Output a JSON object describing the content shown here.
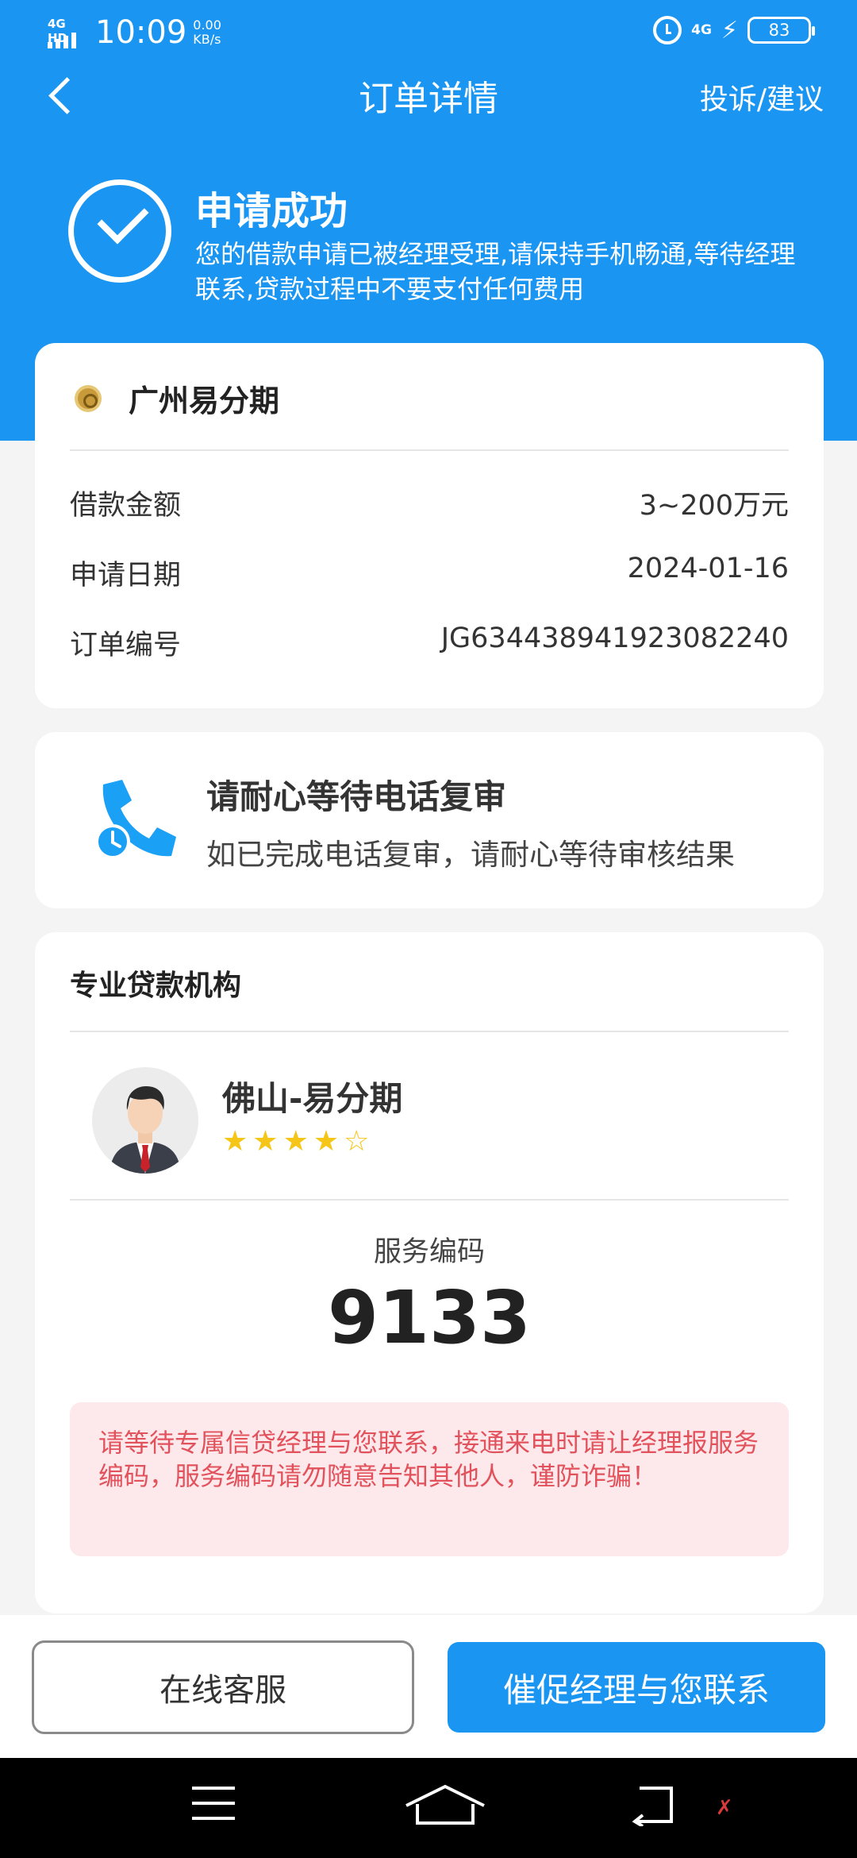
{
  "status_bar": {
    "network": "4G HD",
    "time": "10:09",
    "speed_value": "0.00",
    "speed_unit": "KB/s",
    "network_right": "4G",
    "battery": "83"
  },
  "nav": {
    "title": "订单详情",
    "action": "投诉/建议"
  },
  "banner": {
    "title": "申请成功",
    "desc": "您的借款申请已被经理受理,请保持手机畅通,等待经理联系,贷款过程中不要支付任何费用"
  },
  "lender": {
    "name": "广州易分期",
    "rows": [
      {
        "key": "借款金额",
        "value": "3~200万元"
      },
      {
        "key": "申请日期",
        "value": "2024-01-16"
      },
      {
        "key": "订单编号",
        "value": "JG634438941923082240"
      }
    ]
  },
  "review": {
    "title": "请耐心等待电话复审",
    "desc": "如已完成电话复审，请耐心等待审核结果"
  },
  "agency": {
    "title": "专业贷款机构",
    "agent_name": "佛山-易分期",
    "rating": 4,
    "rating_max": 5,
    "code_label": "服务编码",
    "code_value": "9133",
    "warning": "请等待专属信贷经理与您联系，接通来电时请让经理报服务编码，服务编码请勿随意告知其他人，谨防诈骗！"
  },
  "actions": {
    "service_label": "在线客服",
    "urge_label": "催促经理与您联系"
  },
  "colors": {
    "brand_blue": "#1a96f2",
    "warning_bg": "#fde9eb",
    "warning_text": "#e2525c",
    "star": "#f5c518"
  }
}
